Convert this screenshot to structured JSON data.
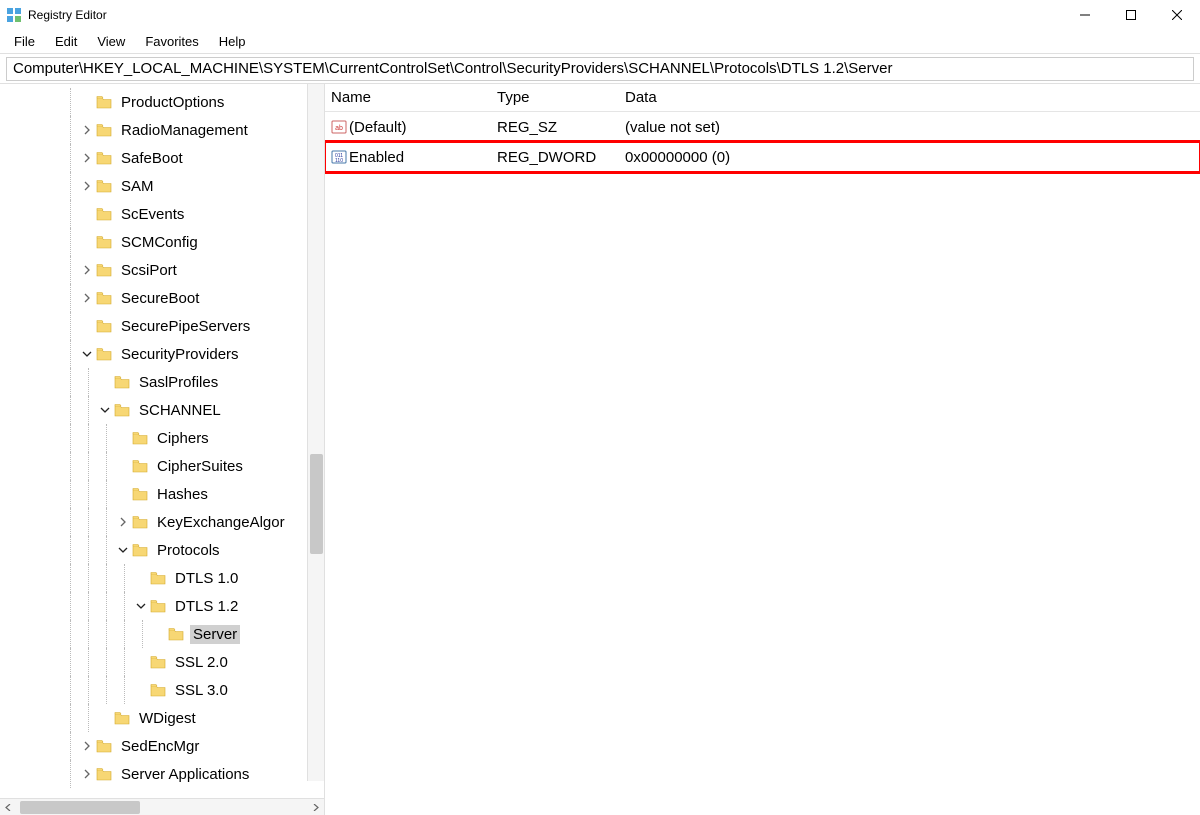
{
  "window": {
    "title": "Registry Editor"
  },
  "menu": {
    "file": "File",
    "edit": "Edit",
    "view": "View",
    "favorites": "Favorites",
    "help": "Help"
  },
  "address": "Computer\\HKEY_LOCAL_MACHINE\\SYSTEM\\CurrentControlSet\\Control\\SecurityProviders\\SCHANNEL\\Protocols\\DTLS 1.2\\Server",
  "columns": {
    "name": "Name",
    "type": "Type",
    "data": "Data"
  },
  "values": [
    {
      "icon": "sz",
      "name": "(Default)",
      "type": "REG_SZ",
      "data": "(value not set)",
      "highlight": false
    },
    {
      "icon": "dw",
      "name": "Enabled",
      "type": "REG_DWORD",
      "data": "0x00000000 (0)",
      "highlight": true
    }
  ],
  "tree": [
    {
      "depth": 0,
      "expander": "none",
      "label": "ProductOptions"
    },
    {
      "depth": 0,
      "expander": "right",
      "label": "RadioManagement"
    },
    {
      "depth": 0,
      "expander": "right",
      "label": "SafeBoot"
    },
    {
      "depth": 0,
      "expander": "right",
      "label": "SAM"
    },
    {
      "depth": 0,
      "expander": "none",
      "label": "ScEvents"
    },
    {
      "depth": 0,
      "expander": "none",
      "label": "SCMConfig"
    },
    {
      "depth": 0,
      "expander": "right",
      "label": "ScsiPort"
    },
    {
      "depth": 0,
      "expander": "right",
      "label": "SecureBoot"
    },
    {
      "depth": 0,
      "expander": "none",
      "label": "SecurePipeServers"
    },
    {
      "depth": 0,
      "expander": "down",
      "label": "SecurityProviders"
    },
    {
      "depth": 1,
      "expander": "none",
      "label": "SaslProfiles"
    },
    {
      "depth": 1,
      "expander": "down",
      "label": "SCHANNEL"
    },
    {
      "depth": 2,
      "expander": "none",
      "label": "Ciphers"
    },
    {
      "depth": 2,
      "expander": "none",
      "label": "CipherSuites"
    },
    {
      "depth": 2,
      "expander": "none",
      "label": "Hashes"
    },
    {
      "depth": 2,
      "expander": "right",
      "label": "KeyExchangeAlgorithms",
      "display": "KeyExchangeAlgor"
    },
    {
      "depth": 2,
      "expander": "down",
      "label": "Protocols"
    },
    {
      "depth": 3,
      "expander": "none",
      "label": "DTLS 1.0"
    },
    {
      "depth": 3,
      "expander": "down",
      "label": "DTLS 1.2"
    },
    {
      "depth": 4,
      "expander": "none",
      "label": "Server",
      "selected": true
    },
    {
      "depth": 3,
      "expander": "none",
      "label": "SSL 2.0"
    },
    {
      "depth": 3,
      "expander": "none",
      "label": "SSL 3.0"
    },
    {
      "depth": 1,
      "expander": "none",
      "label": "WDigest"
    },
    {
      "depth": 0,
      "expander": "right",
      "label": "SedEncMgr"
    },
    {
      "depth": 0,
      "expander": "right",
      "label": "Server Applications"
    }
  ]
}
